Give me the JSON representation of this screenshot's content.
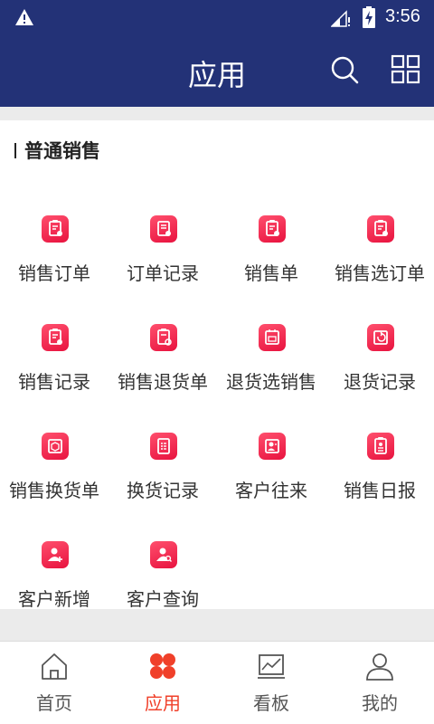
{
  "status_bar": {
    "time": "3:56",
    "icons": [
      "warning-icon",
      "signal-icon",
      "battery-charging-icon"
    ]
  },
  "app_bar": {
    "title": "应用",
    "actions": [
      "search-icon",
      "grid-icon"
    ]
  },
  "section": {
    "title": "普通销售"
  },
  "apps": [
    {
      "label": "销售订单",
      "icon": "order-clipboard-icon"
    },
    {
      "label": "订单记录",
      "icon": "order-record-icon"
    },
    {
      "label": "销售单",
      "icon": "sales-slip-icon"
    },
    {
      "label": "销售选订单",
      "icon": "select-order-icon"
    },
    {
      "label": "销售记录",
      "icon": "sales-record-icon"
    },
    {
      "label": "销售退货单",
      "icon": "sales-return-icon"
    },
    {
      "label": "退货选销售",
      "icon": "return-select-icon"
    },
    {
      "label": "退货记录",
      "icon": "return-record-icon"
    },
    {
      "label": "销售换货单",
      "icon": "exchange-slip-icon"
    },
    {
      "label": "换货记录",
      "icon": "exchange-record-icon"
    },
    {
      "label": "客户往来",
      "icon": "customer-contact-icon"
    },
    {
      "label": "销售日报",
      "icon": "daily-report-icon"
    },
    {
      "label": "客户新增",
      "icon": "add-customer-icon"
    },
    {
      "label": "客户查询",
      "icon": "search-customer-icon"
    }
  ],
  "tabs": [
    {
      "label": "首页",
      "icon": "home-icon",
      "active": false
    },
    {
      "label": "应用",
      "icon": "apps-icon",
      "active": true
    },
    {
      "label": "看板",
      "icon": "dashboard-icon",
      "active": false
    },
    {
      "label": "我的",
      "icon": "profile-icon",
      "active": false
    }
  ],
  "colors": {
    "primary": "#233277",
    "accent": "#f0402a",
    "icon_red": "#ee2a4c"
  }
}
